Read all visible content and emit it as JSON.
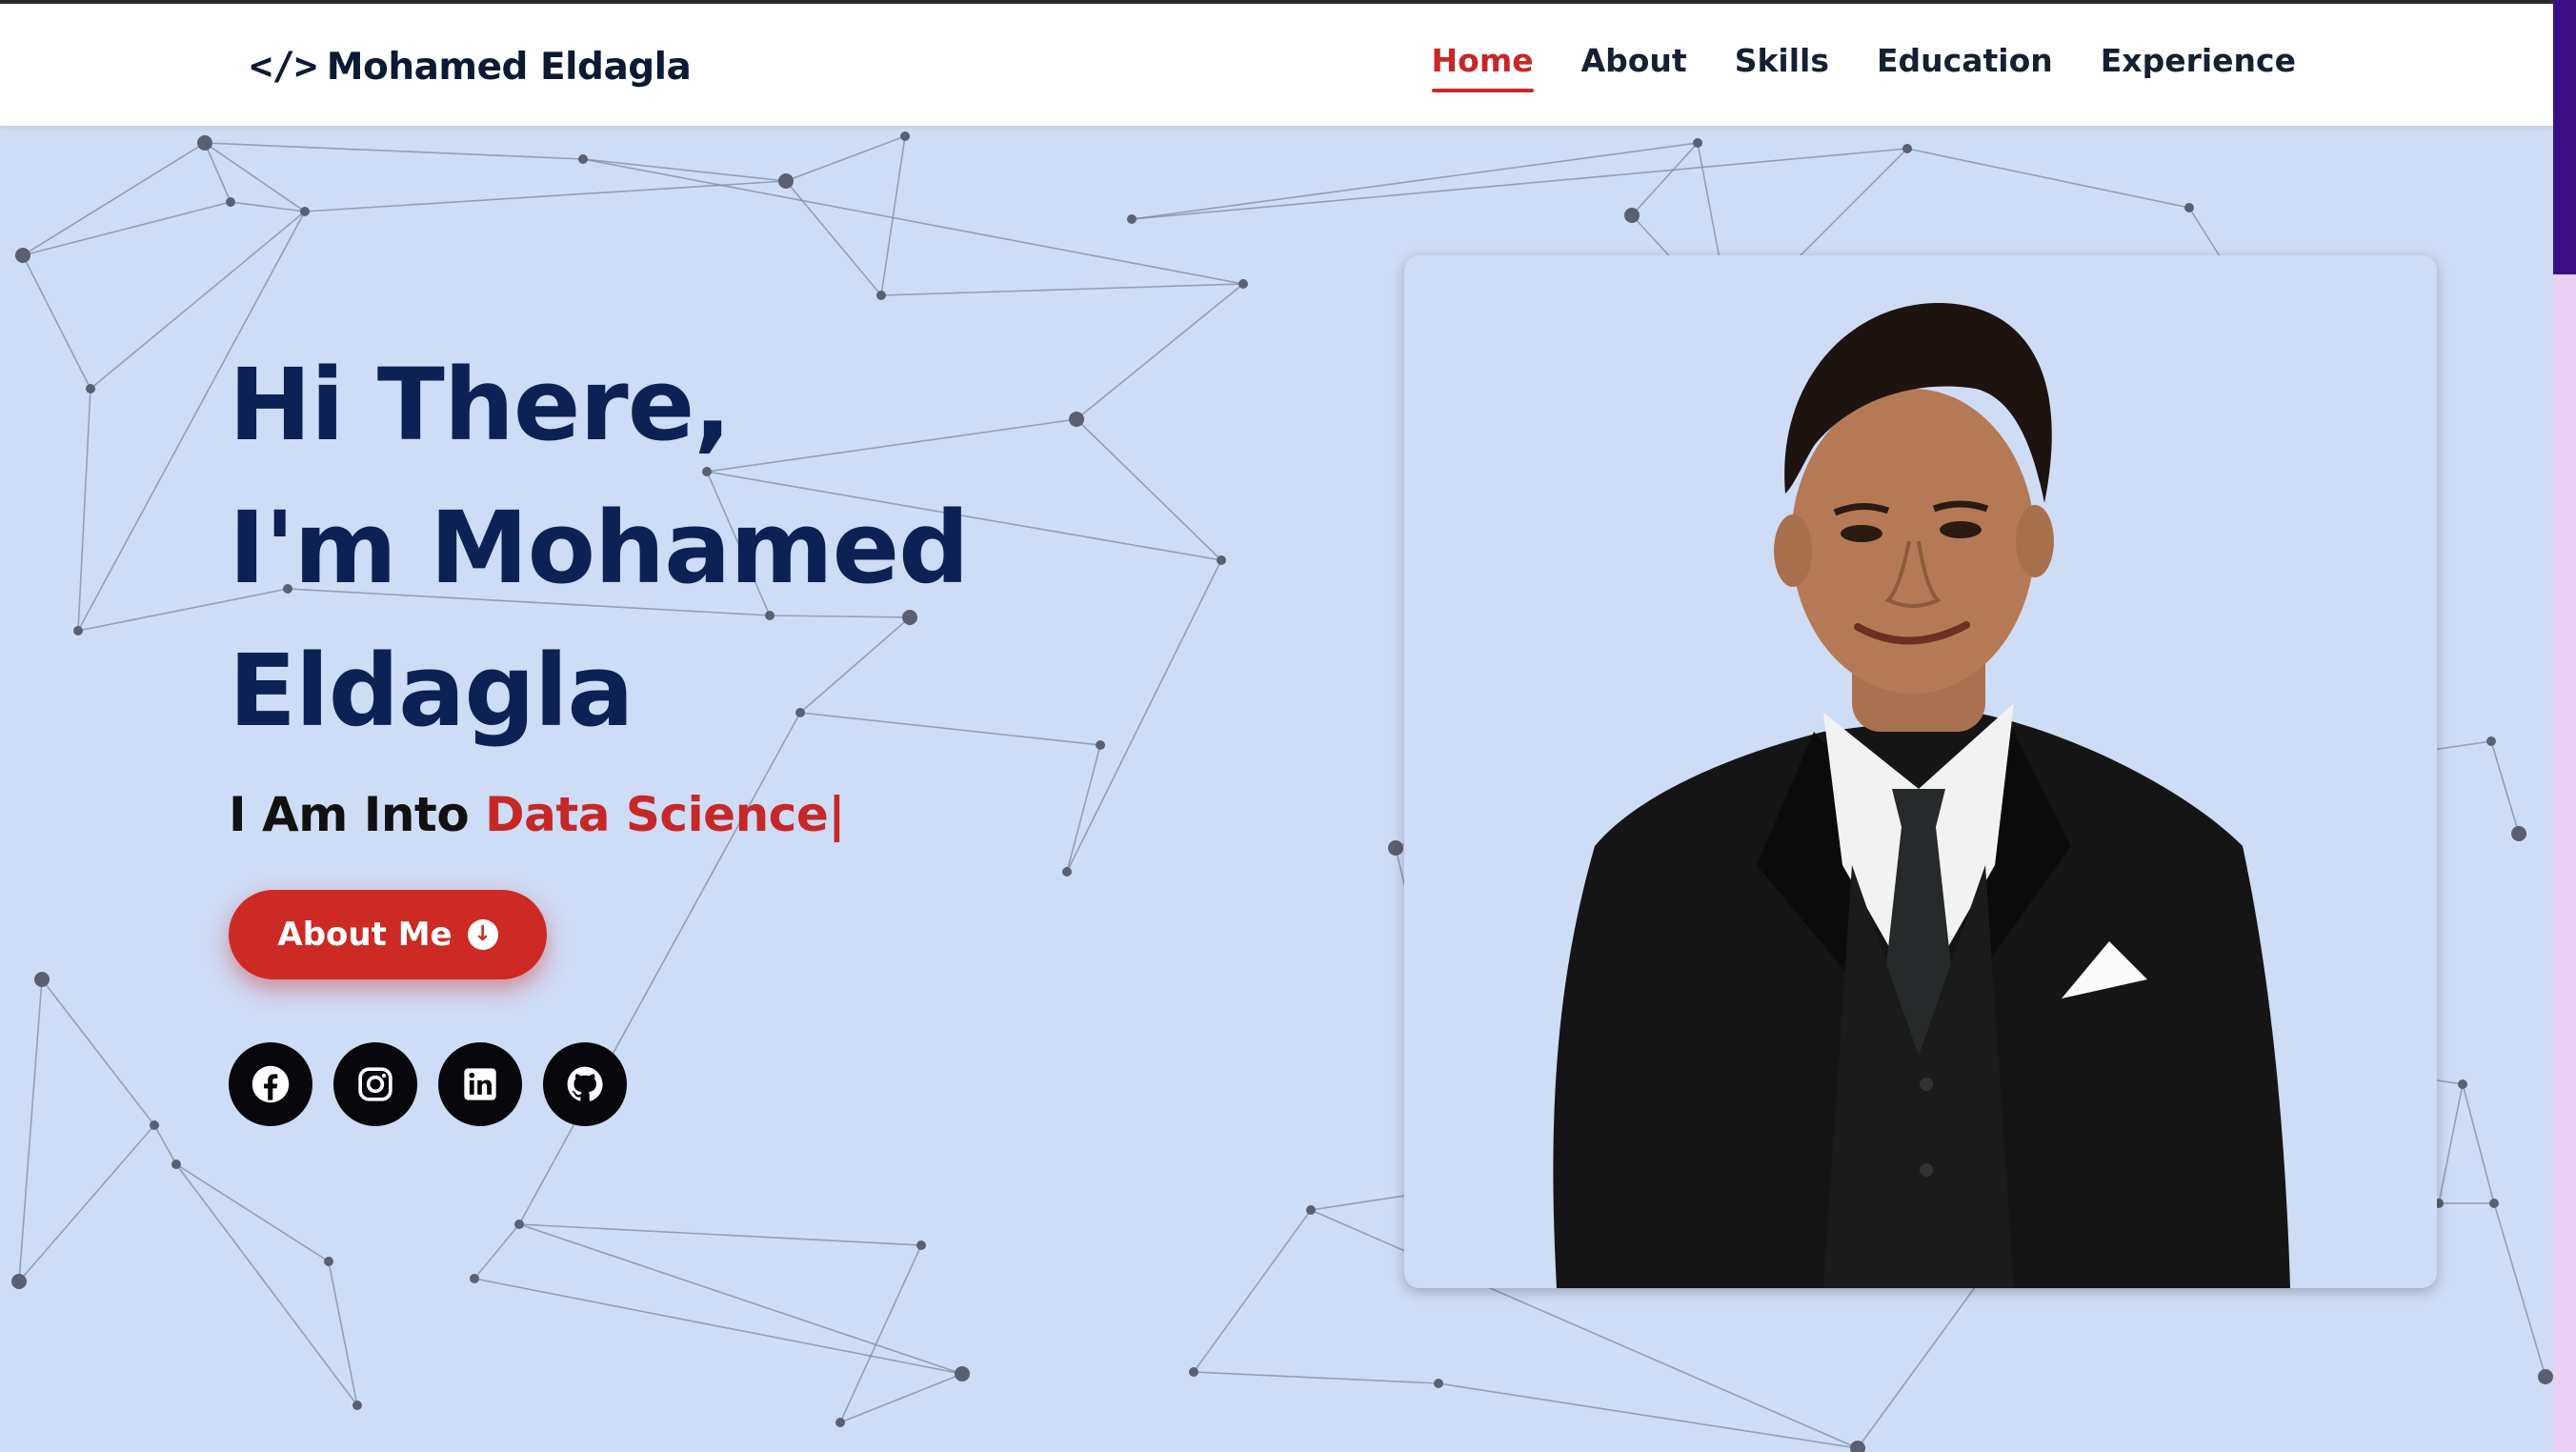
{
  "logo": {
    "icon": "code-icon",
    "text": "Mohamed Eldagla"
  },
  "nav": {
    "items": [
      {
        "label": "Home",
        "active": true
      },
      {
        "label": "About",
        "active": false
      },
      {
        "label": "Skills",
        "active": false
      },
      {
        "label": "Education",
        "active": false
      },
      {
        "label": "Experience",
        "active": false
      }
    ]
  },
  "hero": {
    "line1": "Hi There,",
    "line2": "I'm Mohamed",
    "line3": "Eldagla",
    "subtitle_prefix": "I Am Into",
    "typed_text": "Data Science",
    "cursor": "|",
    "button_label": "About Me",
    "button_icon": "arrow-down-circle-icon"
  },
  "socials": [
    {
      "name": "facebook",
      "icon": "facebook-icon"
    },
    {
      "name": "instagram",
      "icon": "instagram-icon"
    },
    {
      "name": "linkedin",
      "icon": "linkedin-icon"
    },
    {
      "name": "github",
      "icon": "github-icon"
    }
  ],
  "colors": {
    "accent": "#c62828",
    "title": "#0d2155",
    "background": "#cfdcf5",
    "scrollbar_thumb": "#3a0f86"
  }
}
